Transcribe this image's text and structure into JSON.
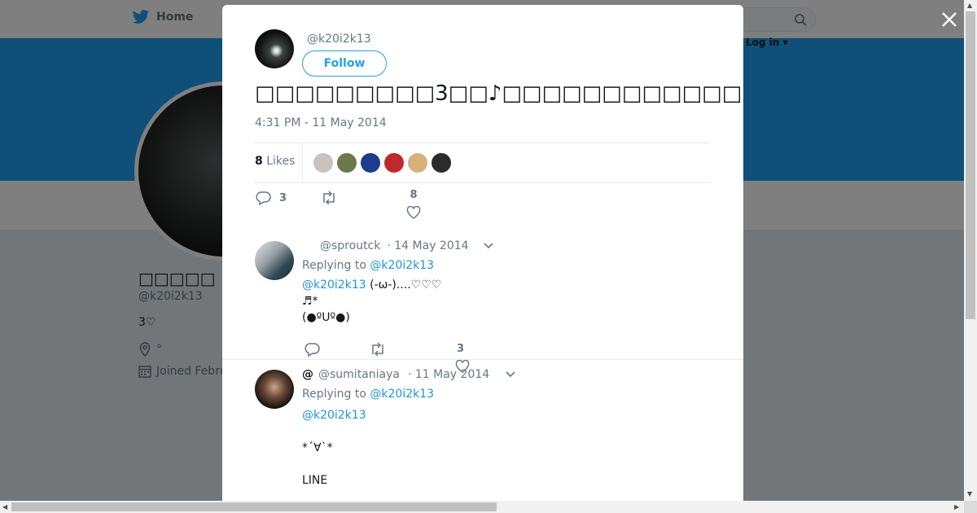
{
  "navbar": {
    "home_label": "Home",
    "login_label": "Log in ▾"
  },
  "profile": {
    "name": "□□□□□",
    "handle": "@k20i2k13",
    "bio": "3♡",
    "location": "°",
    "joined": "Joined Febru"
  },
  "tweet": {
    "handle": "@k20i2k13",
    "follow_label": "Follow",
    "text": "□□□□□□□□□3□□♪□□□□□□□□□□□□□□□□□□□□□□□□□□□□□□□□□□□□□□□□□□□□□□□□",
    "time": "4:31 PM - 11 May 2014",
    "likes_count": "8",
    "likes_label": "Likes",
    "reply_count": "3",
    "like_count": "8",
    "likers": [
      "#c9c2bd",
      "#6a7a4a",
      "#1c3d8f",
      "#c0282a",
      "#d8b07a",
      "#2b2b2b"
    ]
  },
  "replies": [
    {
      "name": "",
      "handle": "@sproutck",
      "date": "· 14 May 2014",
      "replying_prefix": "Replying to",
      "replying_to": "@k20i2k13",
      "mention": "@k20i2k13",
      "text_1": "(-ω-)....♡♡♡",
      "text_2": "♬*",
      "text_3": "(●ºᑌº●)",
      "like_count": "3"
    },
    {
      "name": "@",
      "handle": "@sumitaniaya",
      "date": "· 11 May 2014",
      "replying_prefix": "Replying to",
      "replying_to": "@k20i2k13",
      "mention": "@k20i2k13",
      "text_1": "*´∀`*",
      "text_2": "LINE"
    }
  ],
  "colors": {
    "brand_blue": "#1da1f2",
    "link_blue": "#1b95e0",
    "text_gray": "#657786"
  },
  "icons": [
    "twitter-bird-icon",
    "search-icon",
    "close-icon",
    "reply-icon",
    "retweet-icon",
    "heart-icon",
    "chevron-down-icon",
    "location-icon",
    "calendar-icon"
  ]
}
